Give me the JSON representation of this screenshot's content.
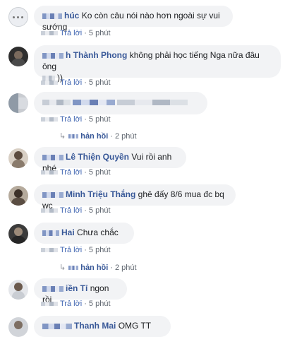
{
  "colors": {
    "link": "#385898",
    "bubble": "#f2f3f5",
    "meta": "#606770"
  },
  "comments": [
    {
      "name": "húc",
      "text": "Ko còn câu nói nào hơn ngoài sự vui sướng",
      "reply": "Trả lời",
      "time": "5 phút"
    },
    {
      "name": "Thành Phong",
      "text": "không phải học tiếng Nga nữa đâu ông",
      "text2": "))",
      "reply": "Trả lời",
      "time": "5 phút"
    },
    {
      "reply": "Trả lời",
      "time": "5 phút"
    },
    {
      "replies": "hản hồi",
      "time": "2 phút"
    },
    {
      "name": "Lê Thiện Quyền",
      "text": "Vui rồi anh nhé",
      "reply": "Trả lời",
      "time": "5 phút"
    },
    {
      "name": "Minh Triệu Thắng",
      "text": "ghê đấy 8/6 mua đc bq wc",
      "reply": "Trả lời",
      "time": "5 phút"
    },
    {
      "name": "Hai",
      "text": "Chưa chắc",
      "reply": "Trả lời",
      "time": "5 phút"
    },
    {
      "replies": "hản hồi",
      "time": "2 phút"
    },
    {
      "name": "iền Tỉ",
      "text": "ngon rồi",
      "reply": "Trả lời",
      "time": "5 phút"
    },
    {
      "name": "Thanh Mai",
      "text": "OMG TT"
    }
  ],
  "separator": "·",
  "name_partial": "h"
}
